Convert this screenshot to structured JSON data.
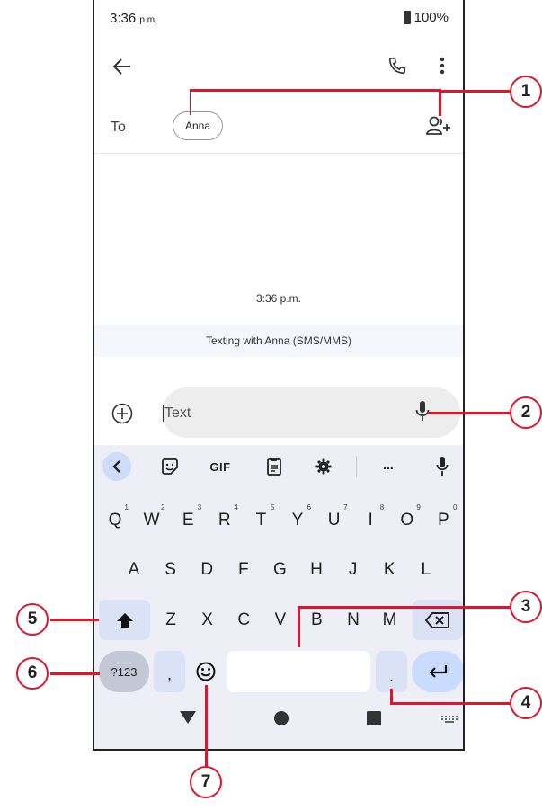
{
  "status": {
    "time": "3:36",
    "time_suffix": "p.m.",
    "battery": "100%"
  },
  "header": {
    "back_icon": "arrow-left-icon",
    "call_icon": "phone-icon",
    "more_icon": "more-vert-icon"
  },
  "recipients": {
    "to_label": "To",
    "chip": "Anna",
    "add_icon": "add-contact-icon"
  },
  "conversation": {
    "timestamp": "3:36 p.m.",
    "banner": "Texting with Anna (SMS/MMS)"
  },
  "composer": {
    "placeholder": "Text",
    "attach_icon": "add-circle-icon",
    "mic_icon": "mic-icon"
  },
  "toolbar": {
    "gif": "GIF",
    "more": "..."
  },
  "keyboard": {
    "row1": [
      {
        "k": "Q",
        "n": "1"
      },
      {
        "k": "W",
        "n": "2"
      },
      {
        "k": "E",
        "n": "3"
      },
      {
        "k": "R",
        "n": "4"
      },
      {
        "k": "T",
        "n": "5"
      },
      {
        "k": "Y",
        "n": "6"
      },
      {
        "k": "U",
        "n": "7"
      },
      {
        "k": "I",
        "n": "8"
      },
      {
        "k": "O",
        "n": "9"
      },
      {
        "k": "P",
        "n": "0"
      }
    ],
    "row2": [
      "A",
      "S",
      "D",
      "F",
      "G",
      "H",
      "J",
      "K",
      "L"
    ],
    "row3": [
      "Z",
      "X",
      "C",
      "V",
      "B",
      "N",
      "M"
    ],
    "symbols": "?123",
    "comma": ",",
    "period": "."
  },
  "callouts": [
    "1",
    "2",
    "3",
    "4",
    "5",
    "6",
    "7"
  ],
  "colors": {
    "annotation": "#e0142a",
    "keyboard_bg": "#edeef6",
    "enter_key": "#c9dcff"
  }
}
